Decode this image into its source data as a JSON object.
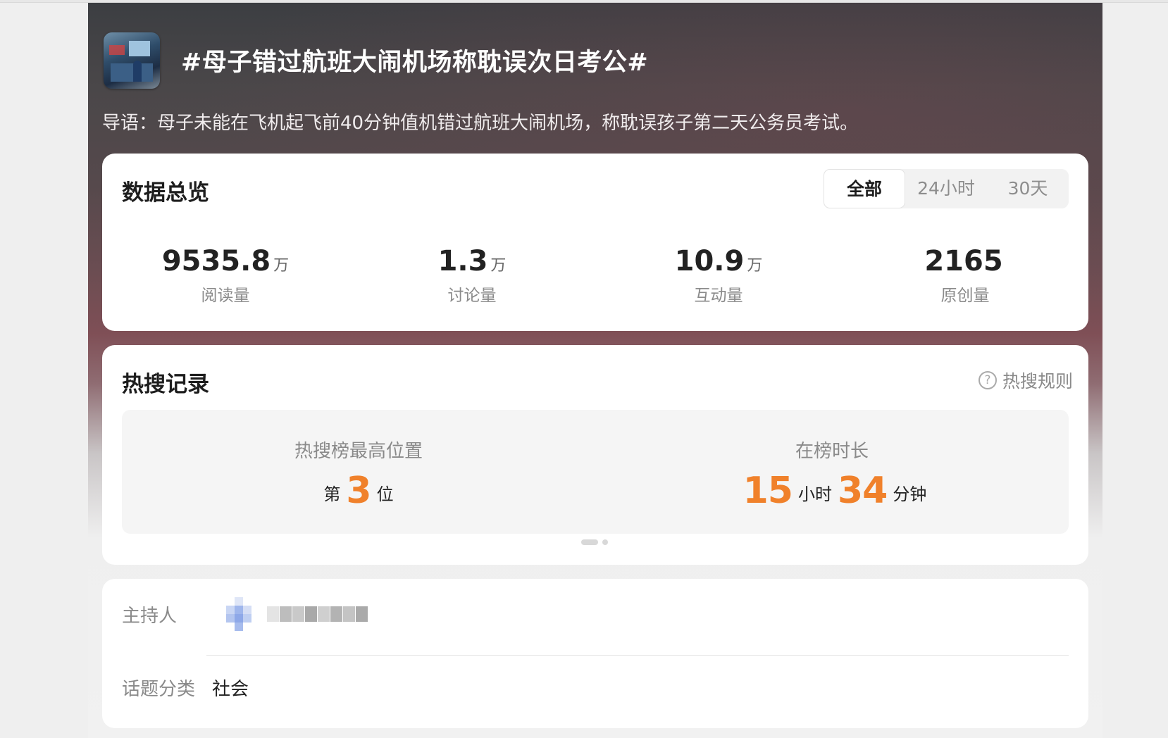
{
  "topic": {
    "title": "#母子错过航班大闹机场称耽误次日考公#",
    "lead": "导语：母子未能在飞机起飞前40分钟值机错过航班大闹机场，称耽误孩子第二天公务员考试。"
  },
  "overview": {
    "title": "数据总览",
    "tabs": [
      {
        "label": "全部",
        "active": true
      },
      {
        "label": "24小时",
        "active": false
      },
      {
        "label": "30天",
        "active": false
      }
    ],
    "stats": [
      {
        "value": "9535.8",
        "unit": "万",
        "label": "阅读量"
      },
      {
        "value": "1.3",
        "unit": "万",
        "label": "讨论量"
      },
      {
        "value": "10.9",
        "unit": "万",
        "label": "互动量"
      },
      {
        "value": "2165",
        "unit": "",
        "label": "原创量"
      }
    ]
  },
  "hot_search": {
    "title": "热搜记录",
    "rules_link": "热搜规则",
    "help_icon": "?",
    "highest_rank": {
      "label": "热搜榜最高位置",
      "prefix": "第",
      "value": "3",
      "suffix": "位"
    },
    "duration": {
      "label": "在榜时长",
      "hours": "15",
      "hours_unit": "小时",
      "minutes": "34",
      "minutes_unit": "分钟"
    }
  },
  "info": {
    "host_label": "主持人",
    "category_label": "话题分类",
    "category_value": "社会"
  },
  "colors": {
    "accent_orange": "#f0812b",
    "card_bg": "#ffffff",
    "muted_text": "#8a8a8a"
  }
}
